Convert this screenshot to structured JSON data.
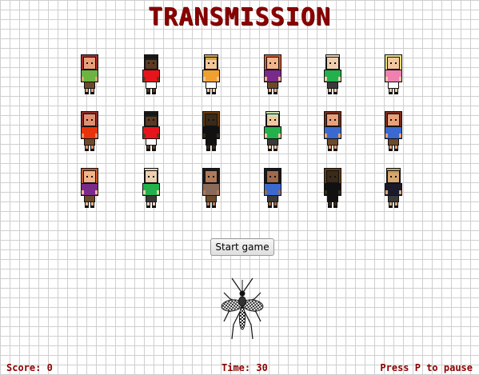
{
  "title": "TRANSMISSION",
  "start_button_label": "Start game",
  "hud": {
    "score": "Score: 0",
    "time": "Time: 30",
    "pause_hint": "Press P to pause"
  },
  "colors": {
    "title": "#8b0000",
    "grid": "#cfcfcf"
  },
  "people": [
    {
      "hair": "#a52a2a",
      "skin": "#e8a07a",
      "shirt": "#6db33f",
      "pants": "#6b4a2b",
      "style": "long"
    },
    {
      "hair": "#1a1a1a",
      "skin": "#5a3a22",
      "shirt": "#e8141b",
      "pants": "#ffffff",
      "style": "short"
    },
    {
      "hair": "#d4a64a",
      "skin": "#f2c79a",
      "shirt": "#f0a030",
      "pants": "#ffffff",
      "style": "short"
    },
    {
      "hair": "#d4572a",
      "skin": "#f2b48a",
      "shirt": "#7a2a8a",
      "pants": "#6b4a2b",
      "style": "long"
    },
    {
      "hair": "#eecfb0",
      "skin": "#eecfb0",
      "shirt": "#22b14c",
      "pants": "#3a3a3a",
      "style": "bald"
    },
    {
      "hair": "#e8e07a",
      "skin": "#f2c7a0",
      "shirt": "#f080b0",
      "pants": "#ffffff",
      "style": "long"
    },
    {
      "hair": "#8b2a2a",
      "skin": "#e09070",
      "shirt": "#e8320a",
      "pants": "#6b4a2b",
      "style": "long"
    },
    {
      "hair": "#1a1a1a",
      "skin": "#5a3a22",
      "shirt": "#e8141b",
      "pants": "#ffffff",
      "style": "short"
    },
    {
      "hair": "#6b3a0a",
      "skin": "#3a2a1a",
      "shirt": "#111111",
      "pants": "#111111",
      "style": "hood"
    },
    {
      "hair": "#c8e0b0",
      "skin": "#f2c7a0",
      "shirt": "#22b14c",
      "pants": "#3a3a3a",
      "style": "bald"
    },
    {
      "hair": "#7a2a1a",
      "skin": "#e8a07a",
      "shirt": "#3a6ad0",
      "pants": "#6b4a2b",
      "style": "curly"
    },
    {
      "hair": "#7a2a1a",
      "skin": "#e8a07a",
      "shirt": "#3a6ad0",
      "pants": "#6b4a2b",
      "style": "curly"
    },
    {
      "hair": "#c85a2a",
      "skin": "#f2b48a",
      "shirt": "#7a2a8a",
      "pants": "#6b4a2b",
      "style": "curly"
    },
    {
      "hair": "#eecfb0",
      "skin": "#eecfb0",
      "shirt": "#22b14c",
      "pants": "#3a3a3a",
      "style": "bald"
    },
    {
      "hair": "#1a1a1a",
      "skin": "#b07a5a",
      "shirt": "#8a6a5a",
      "pants": "#6b4a2b",
      "style": "curly"
    },
    {
      "hair": "#1a1a1a",
      "skin": "#a06a4a",
      "shirt": "#3a6ad0",
      "pants": "#3a3a3a",
      "style": "curly"
    },
    {
      "hair": "#6b3a0a",
      "skin": "#3a2a1a",
      "shirt": "#111111",
      "pants": "#111111",
      "style": "hood"
    },
    {
      "hair": "#c8a060",
      "skin": "#d8a870",
      "shirt": "#1a1a2a",
      "pants": "#3a3a3a",
      "style": "short"
    }
  ]
}
